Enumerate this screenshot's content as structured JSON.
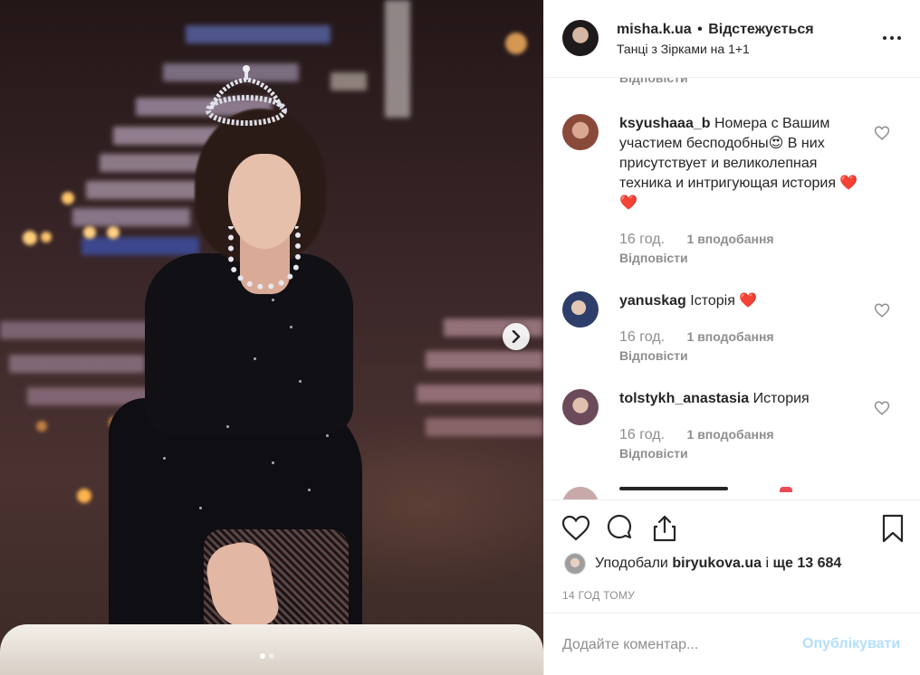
{
  "post": {
    "username": "misha.k.ua",
    "separator": "•",
    "follow_status": "Відстежується",
    "location": "Танці з Зірками на 1+1"
  },
  "comments_top_cut_reply": "Відповісти",
  "comments": [
    {
      "username": "ksyushaaa_b",
      "text": "Номера с Вашим участием бесподобны😍 В них присутствует и великолепная техника и интригующая история ❤️❤️",
      "time": "16 год.",
      "likes": "1 вподобання",
      "reply": "Відповісти",
      "avatar_color": "#8a4a3a"
    },
    {
      "username": "yanuskag",
      "text": "Історія ❤️",
      "time": "16 год.",
      "likes": "1 вподобання",
      "reply": "Відповісти",
      "avatar_color": "#2d3e6a"
    },
    {
      "username": "tolstykh_anastasia",
      "text": "История",
      "time": "16 год.",
      "likes": "1 вподобання",
      "reply": "Відповісти",
      "avatar_color": "#6b4b5a"
    }
  ],
  "likes_row": {
    "prefix": "Уподобали",
    "liker": "biryukova.ua",
    "middle": "і",
    "others": "ще 13 684"
  },
  "timestamp": "14 ГОД ТОМУ",
  "add_comment": {
    "placeholder": "Додайте коментар...",
    "post_label": "Опублікувати"
  },
  "icons": {
    "more": "more-horizontal-icon",
    "like": "heart-icon",
    "comment": "comment-bubble-icon",
    "share": "share-icon",
    "save": "bookmark-icon",
    "next": "chevron-right-icon"
  },
  "colors": {
    "heart_red": "#ed4956",
    "meta_gray": "#8e8e8e",
    "post_blue_disabled": "#b2dffc"
  },
  "carousel": {
    "current": 1,
    "total": 2
  }
}
